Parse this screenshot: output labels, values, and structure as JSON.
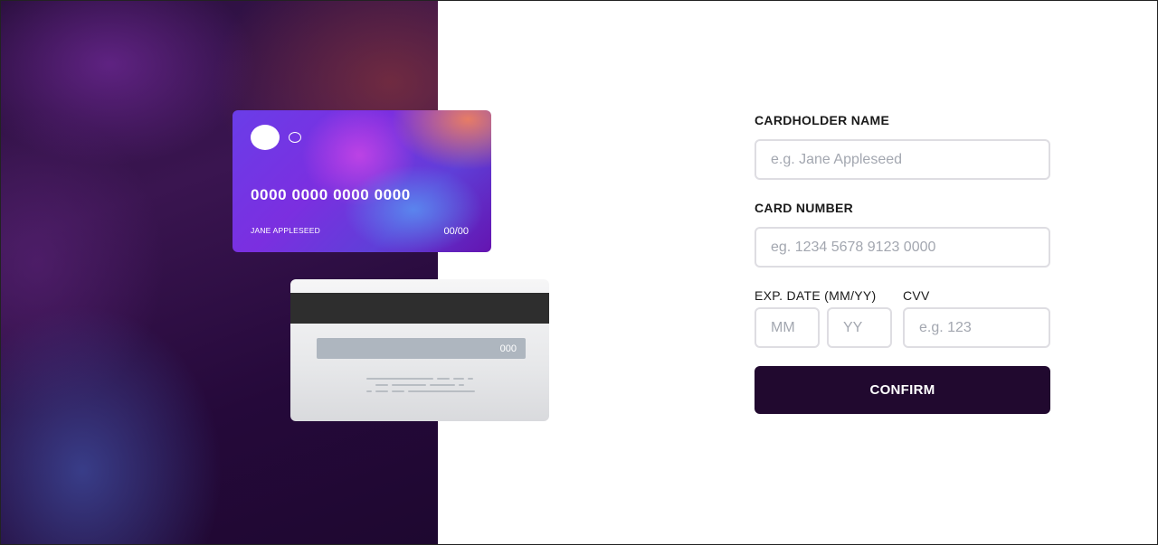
{
  "card_front": {
    "number": "0000 0000 0000 0000",
    "name": "JANE APPLESEED",
    "expiry": "00/00"
  },
  "card_back": {
    "cvc": "000"
  },
  "form": {
    "cardholder_label": "CARDHOLDER NAME",
    "cardholder_placeholder": "e.g. Jane Appleseed",
    "number_label": "CARD NUMBER",
    "number_placeholder": "eg. 1234 5678 9123 0000",
    "exp_label": "EXP. DATE (MM/YY)",
    "month_placeholder": "MM",
    "year_placeholder": "YY",
    "cvc_label": "CVV",
    "cvc_placeholder": "e.g. 123",
    "confirm_label": "CONFIRM"
  },
  "colors": {
    "button": "#21092f",
    "input_border": "#dedde2",
    "placeholder": "#a3a7b0"
  }
}
